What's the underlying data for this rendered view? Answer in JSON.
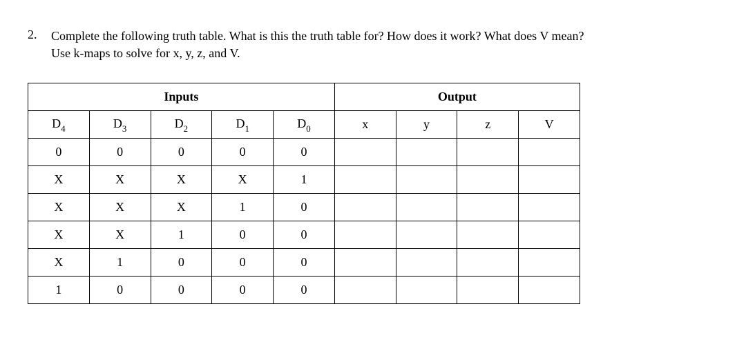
{
  "question": {
    "number": "2.",
    "text_line1": "Complete the following truth table. What is this the truth table for? How does it work? What does V mean?",
    "text_line2": "Use k-maps to solve for x, y, z, and V."
  },
  "headers": {
    "inputs": "Inputs",
    "output": "Output"
  },
  "cols": {
    "d4": "D",
    "d4_sub": "4",
    "d3": "D",
    "d3_sub": "3",
    "d2": "D",
    "d2_sub": "2",
    "d1": "D",
    "d1_sub": "1",
    "d0": "D",
    "d0_sub": "0",
    "x": "x",
    "y": "y",
    "z": "z",
    "v": "V"
  },
  "rows": [
    {
      "d4": "0",
      "d3": "0",
      "d2": "0",
      "d1": "0",
      "d0": "0",
      "x": "",
      "y": "",
      "z": "",
      "v": ""
    },
    {
      "d4": "X",
      "d3": "X",
      "d2": "X",
      "d1": "X",
      "d0": "1",
      "x": "",
      "y": "",
      "z": "",
      "v": ""
    },
    {
      "d4": "X",
      "d3": "X",
      "d2": "X",
      "d1": "1",
      "d0": "0",
      "x": "",
      "y": "",
      "z": "",
      "v": ""
    },
    {
      "d4": "X",
      "d3": "X",
      "d2": "1",
      "d1": "0",
      "d0": "0",
      "x": "",
      "y": "",
      "z": "",
      "v": ""
    },
    {
      "d4": "X",
      "d3": "1",
      "d2": "0",
      "d1": "0",
      "d0": "0",
      "x": "",
      "y": "",
      "z": "",
      "v": ""
    },
    {
      "d4": "1",
      "d3": "0",
      "d2": "0",
      "d1": "0",
      "d0": "0",
      "x": "",
      "y": "",
      "z": "",
      "v": ""
    }
  ]
}
